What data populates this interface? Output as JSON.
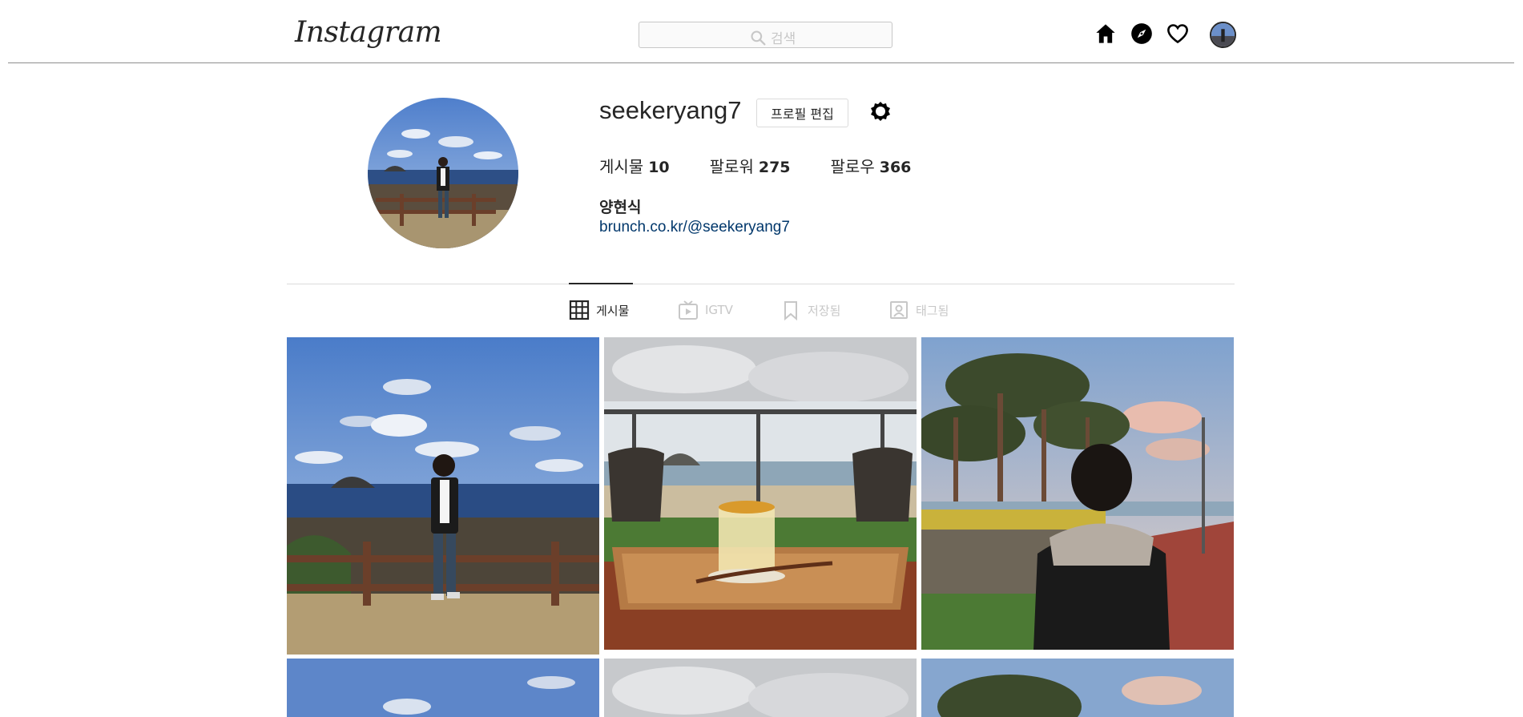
{
  "header": {
    "logo_text": "Instagram",
    "search_placeholder": "검색",
    "icons": [
      "home-icon",
      "explore-icon",
      "heart-icon",
      "avatar"
    ]
  },
  "profile": {
    "username": "seekeryang7",
    "edit_button": "프로필 편집",
    "stats": [
      {
        "label": "게시물",
        "value": "10"
      },
      {
        "label": "팔로워",
        "value": "275"
      },
      {
        "label": "팔로우",
        "value": "366"
      }
    ],
    "full_name": "양현식",
    "link": "brunch.co.kr/@seekeryang7"
  },
  "tabs": [
    {
      "label": "게시물",
      "active": true,
      "icon": "grid-icon"
    },
    {
      "label": "IGTV",
      "active": false,
      "icon": "igtv-icon"
    },
    {
      "label": "저장됨",
      "active": false,
      "icon": "bookmark-icon"
    },
    {
      "label": "태그됨",
      "active": false,
      "icon": "tagged-icon"
    }
  ],
  "colors": {
    "text": "#262626",
    "link": "#00376b",
    "border": "#dbdbdb",
    "inactive": "#c7c7c7"
  }
}
